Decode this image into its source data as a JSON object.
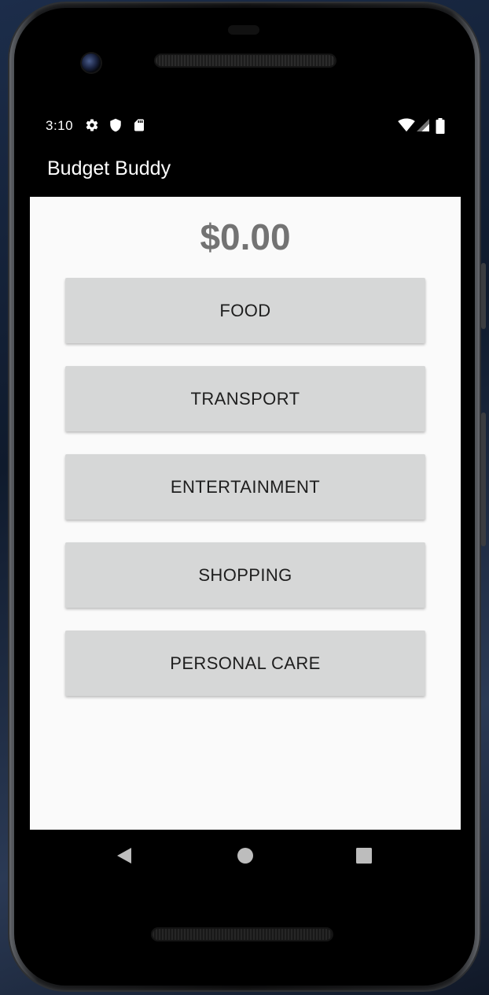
{
  "status_bar": {
    "time": "3:10",
    "icons": [
      "gear-icon",
      "shield-icon",
      "sd-card-icon",
      "wifi-icon",
      "signal-icon",
      "battery-icon"
    ]
  },
  "app_bar": {
    "title": "Budget Buddy"
  },
  "main": {
    "total": "$0.00",
    "categories": [
      {
        "label": "FOOD"
      },
      {
        "label": "TRANSPORT"
      },
      {
        "label": "ENTERTAINMENT"
      },
      {
        "label": "SHOPPING"
      },
      {
        "label": "PERSONAL CARE"
      }
    ]
  },
  "nav_bar": {
    "icons": [
      "back-icon",
      "home-icon",
      "recents-icon"
    ]
  },
  "colors": {
    "app_bar": "#000000",
    "content_bg": "#fafafa",
    "button_bg": "#d6d7d7",
    "total_text": "#737373"
  }
}
